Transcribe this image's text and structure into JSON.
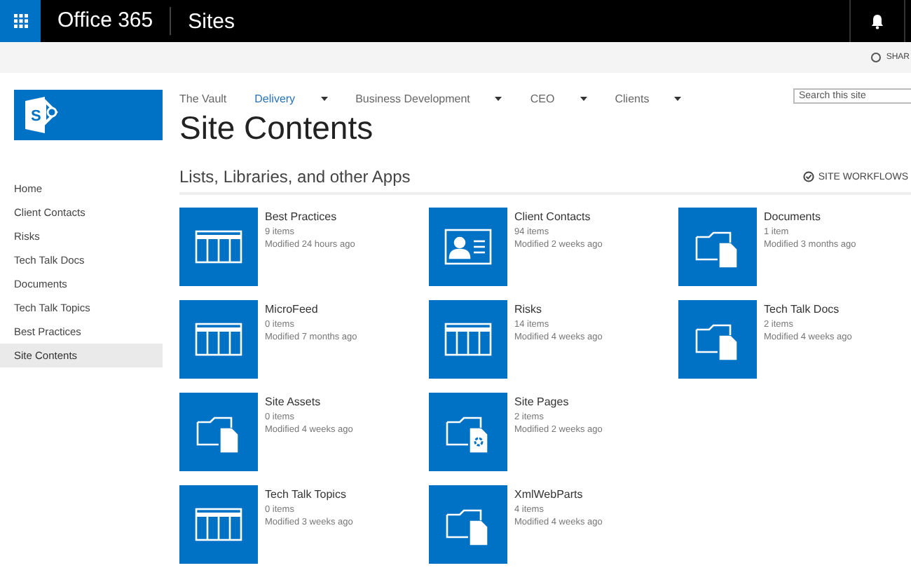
{
  "suite_bar": {
    "brand": "Office 365",
    "app": "Sites"
  },
  "command_bar": {
    "share": "SHAR"
  },
  "top_nav": [
    {
      "label": "The Vault",
      "selected": false,
      "dropdown": false
    },
    {
      "label": "Delivery",
      "selected": true,
      "dropdown": true
    },
    {
      "label": "Business Development",
      "selected": false,
      "dropdown": true
    },
    {
      "label": "CEO",
      "selected": false,
      "dropdown": true
    },
    {
      "label": "Clients",
      "selected": false,
      "dropdown": true
    }
  ],
  "logo": {
    "letter": "S"
  },
  "search": {
    "placeholder": "Search this site"
  },
  "page_title": "Site Contents",
  "sidebar": {
    "items": [
      {
        "label": "Home",
        "selected": false
      },
      {
        "label": "Client Contacts",
        "selected": false
      },
      {
        "label": "Risks",
        "selected": false
      },
      {
        "label": "Tech Talk Docs",
        "selected": false
      },
      {
        "label": "Documents",
        "selected": false
      },
      {
        "label": "Tech Talk Topics",
        "selected": false
      },
      {
        "label": "Best Practices",
        "selected": false
      },
      {
        "label": "Site Contents",
        "selected": true
      }
    ]
  },
  "apps": {
    "heading": "Lists, Libraries, and other Apps",
    "workflows": "SITE WORKFLOWS",
    "rows": [
      [
        {
          "kind": "list",
          "title": "Best Practices",
          "count": "9 items",
          "modified": "Modified 24 hours ago"
        },
        {
          "kind": "contacts",
          "title": "Client Contacts",
          "count": "94 items",
          "modified": "Modified 2 weeks ago"
        },
        {
          "kind": "library",
          "title": "Documents",
          "count": "1 item",
          "modified": "Modified 3 months ago"
        }
      ],
      [
        {
          "kind": "list",
          "title": "MicroFeed",
          "count": "0 items",
          "modified": "Modified 7 months ago"
        },
        {
          "kind": "list",
          "title": "Risks",
          "count": "14 items",
          "modified": "Modified 4 weeks ago"
        },
        {
          "kind": "library",
          "title": "Tech Talk Docs",
          "count": "2 items",
          "modified": "Modified 4 weeks ago"
        }
      ],
      [
        {
          "kind": "library",
          "title": "Site Assets",
          "count": "0 items",
          "modified": "Modified 4 weeks ago"
        },
        {
          "kind": "pages",
          "title": "Site Pages",
          "count": "2 items",
          "modified": "Modified 2 weeks ago"
        }
      ],
      [
        {
          "kind": "list",
          "title": "Tech Talk Topics",
          "count": "0 items",
          "modified": "Modified 3 weeks ago"
        },
        {
          "kind": "library",
          "title": "XmlWebParts",
          "count": "4 items",
          "modified": "Modified 4 weeks ago"
        }
      ]
    ]
  }
}
